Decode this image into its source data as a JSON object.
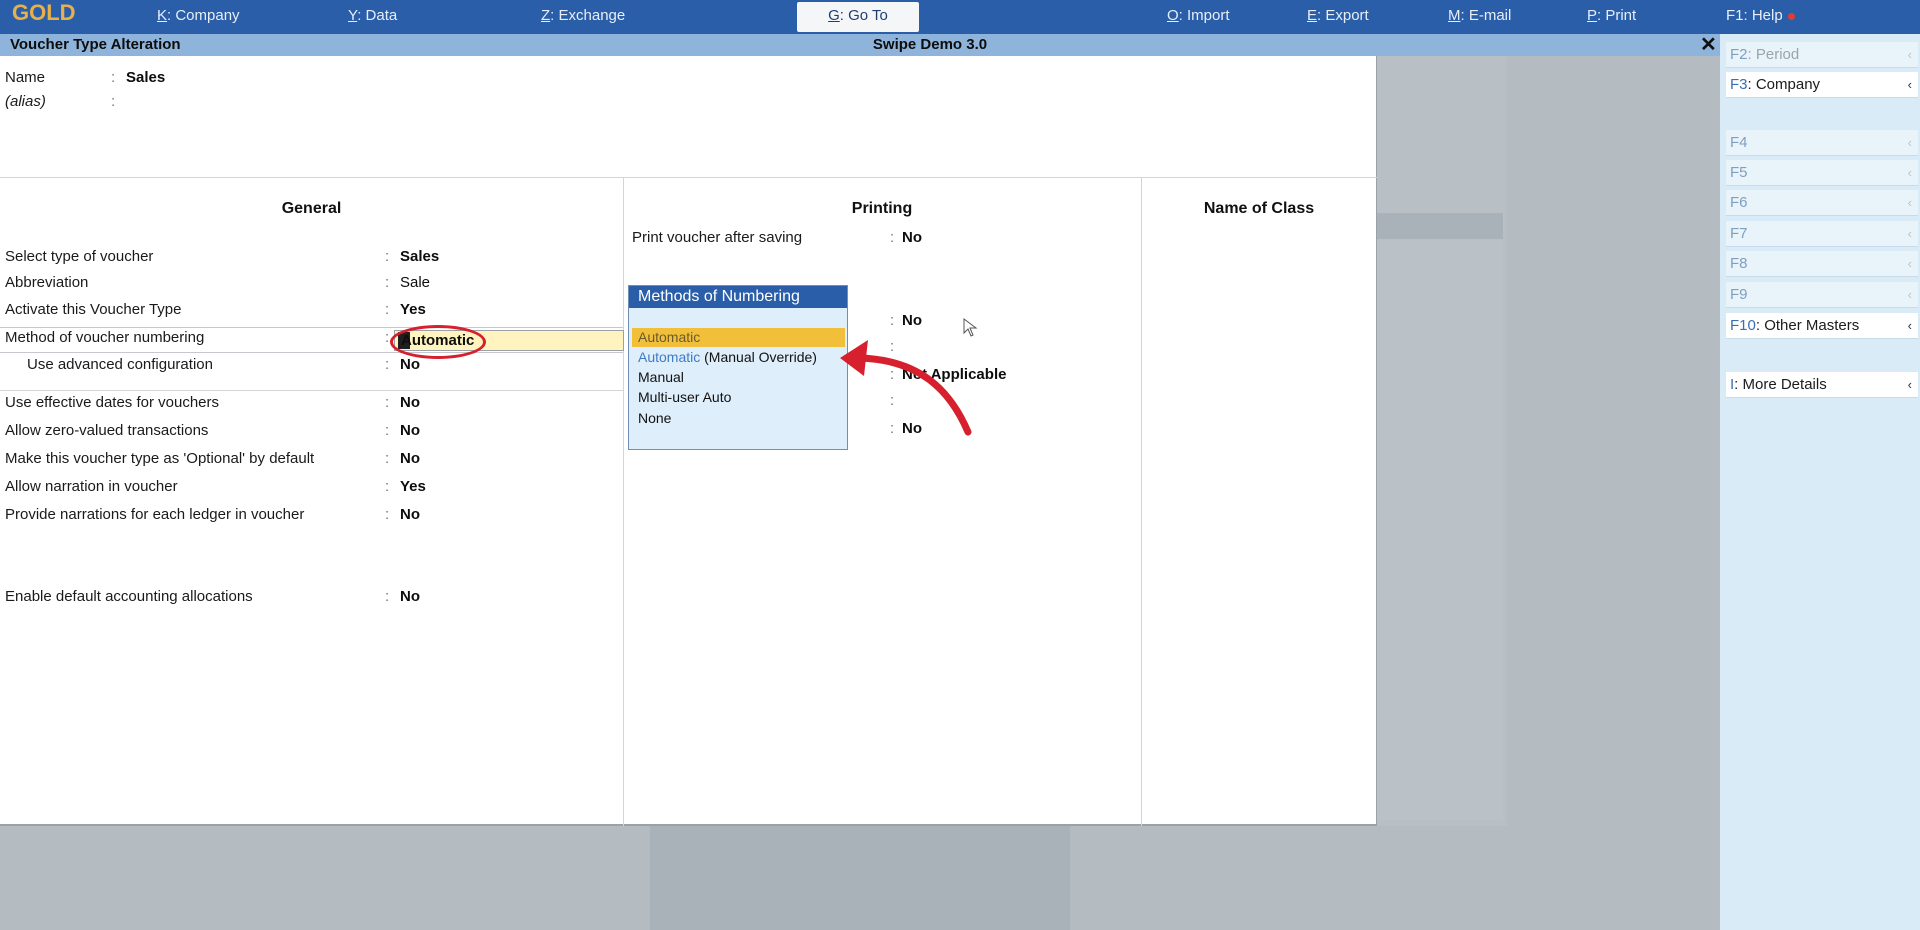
{
  "menubar": {
    "brand": "GOLD",
    "items": [
      {
        "key": "K",
        "label": ": Company"
      },
      {
        "key": "Y",
        "label": ": Data"
      },
      {
        "key": "Z",
        "label": ": Exchange"
      },
      {
        "key": "G",
        "label": ": Go To"
      },
      {
        "key": "O",
        "label": ": Import"
      },
      {
        "key": "E",
        "label": ": Export"
      },
      {
        "key": "M",
        "label": ": E-mail"
      },
      {
        "key": "P",
        "label": ": Print"
      },
      {
        "key": "F1",
        "label": ": Help"
      }
    ]
  },
  "titlebar": {
    "screen_title": "Voucher Type Alteration",
    "company": "Swipe Demo 3.0",
    "close_icon": "close-icon"
  },
  "header": {
    "name_label": "Name",
    "name_value": "Sales",
    "alias_label": "(alias)",
    "colon": ":"
  },
  "general": {
    "title": "General",
    "rows": [
      {
        "label": "Select type of voucher",
        "value": "Sales"
      },
      {
        "label": "Abbreviation",
        "value": "Sale"
      },
      {
        "label": "Activate this Voucher Type",
        "value": "Yes"
      },
      {
        "label": "Method of voucher numbering",
        "value": "Automatic"
      },
      {
        "label": "Use advanced configuration",
        "value": "No"
      },
      {
        "label": "Use effective dates for vouchers",
        "value": "No"
      },
      {
        "label": "Allow zero-valued transactions",
        "value": "No"
      },
      {
        "label": "Make this voucher type as 'Optional' by default",
        "value": "No"
      },
      {
        "label": "Allow narration in voucher",
        "value": "Yes"
      },
      {
        "label": "Provide narrations for each ledger in voucher",
        "value": "No"
      },
      {
        "label": "Enable default accounting allocations",
        "value": "No"
      }
    ]
  },
  "printing": {
    "title": "Printing",
    "print_after_saving_label": "Print voucher after saving",
    "print_after_saving_value": "No",
    "value_2": "No",
    "value_3": "Not Applicable",
    "value_4": "No"
  },
  "name_of_class": {
    "title": "Name of Class"
  },
  "popup": {
    "title": "Methods of Numbering",
    "items": [
      {
        "label": "Automatic"
      },
      {
        "label": "Automatic",
        "suffix": " (Manual Override)"
      },
      {
        "label": "Manual"
      },
      {
        "label": "Multi-user Auto"
      },
      {
        "label": "None"
      }
    ],
    "selected": "Automatic"
  },
  "sidebar": {
    "buttons": [
      {
        "key": "F2",
        "label": ": Period",
        "enabled": false
      },
      {
        "key": "F3",
        "label": ": Company",
        "enabled": true
      },
      {
        "key": "F4",
        "label": "",
        "enabled": false
      },
      {
        "key": "F5",
        "label": "",
        "enabled": false
      },
      {
        "key": "F6",
        "label": "",
        "enabled": false
      },
      {
        "key": "F7",
        "label": "",
        "enabled": false
      },
      {
        "key": "F8",
        "label": "",
        "enabled": false
      },
      {
        "key": "F9",
        "label": "",
        "enabled": false
      },
      {
        "key": "F10",
        "label": ": Other Masters",
        "enabled": true
      },
      {
        "key": "I",
        "label": ": More Details",
        "enabled": true
      }
    ]
  },
  "colors": {
    "menubar": "#2a5ea8",
    "brand": "#e8b04a",
    "titlebar": "#8fb4db",
    "annotation": "#d6202e",
    "selection": "#f2bf3b"
  }
}
